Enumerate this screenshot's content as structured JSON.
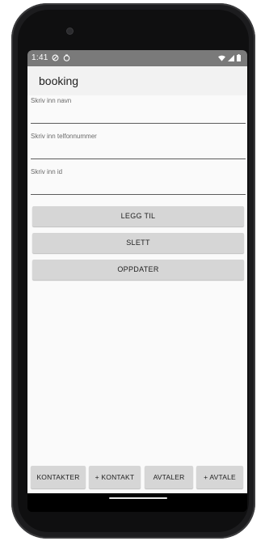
{
  "status_bar": {
    "time": "1:41"
  },
  "app_bar": {
    "title": "booking"
  },
  "form": {
    "name_label": "Skriv inn navn",
    "phone_label": "Skriv inn telfonnummer",
    "id_label": "Skriv inn id"
  },
  "actions": {
    "add_label": "LEGG TIL",
    "delete_label": "SLETT",
    "update_label": "OPPDATER"
  },
  "bottom_nav": {
    "contacts_label": "KONTAKTER",
    "add_contact_label": "+ KONTAKT",
    "appointments_label": "AVTALER",
    "add_appointment_label": "+ AVTALE"
  },
  "icons": {
    "status_left": [
      "do-not-disturb-icon",
      "sync-icon"
    ],
    "status_right": [
      "wifi-icon",
      "signal-icon",
      "battery-icon"
    ]
  },
  "colors": {
    "status_bar": "#7a7a7a",
    "app_bar": "#f2f2f2",
    "button": "#d6d6d6",
    "background": "#fafafa"
  }
}
